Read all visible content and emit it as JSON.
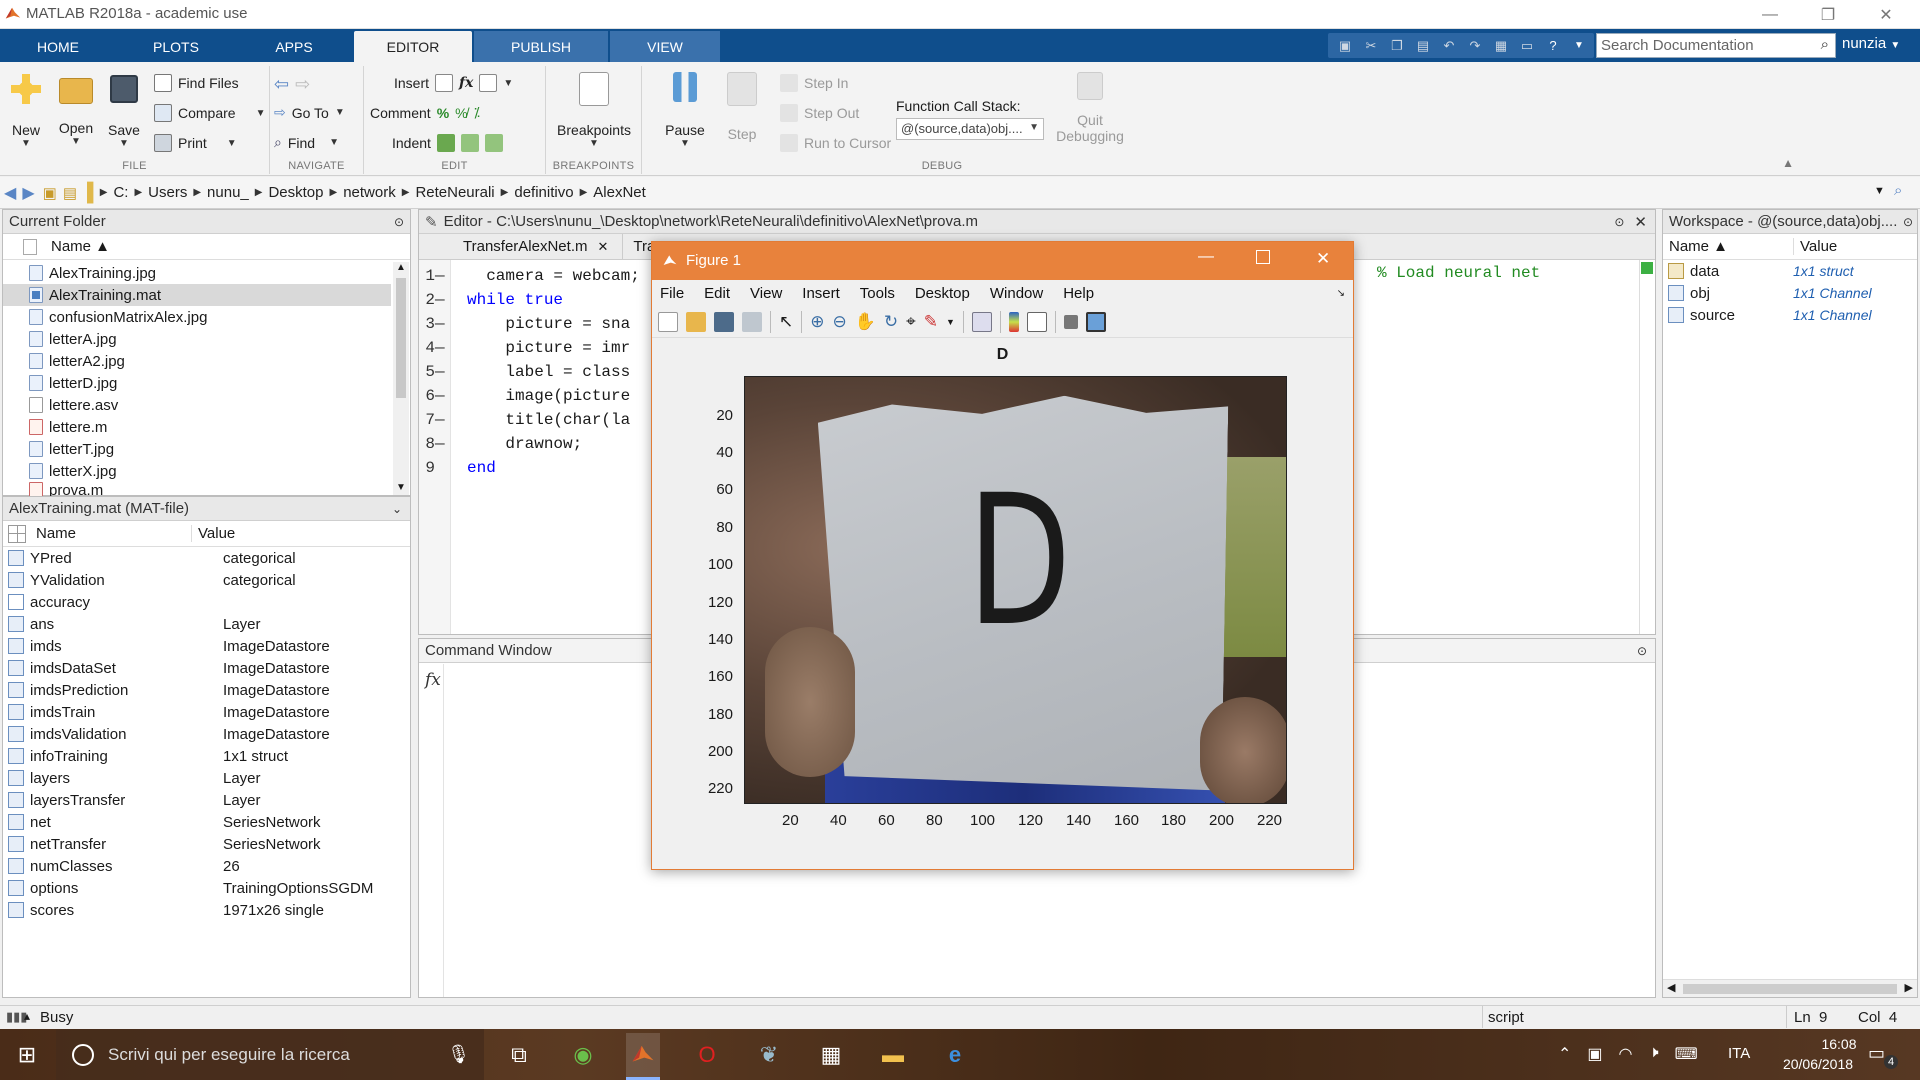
{
  "window": {
    "title": "MATLAB R2018a - academic use",
    "min": "—",
    "max": "❐",
    "close": "✕"
  },
  "tabs": [
    {
      "label": "HOME"
    },
    {
      "label": "PLOTS"
    },
    {
      "label": "APPS"
    },
    {
      "label": "EDITOR"
    },
    {
      "label": "PUBLISH"
    },
    {
      "label": "VIEW"
    }
  ],
  "search": {
    "placeholder": "Search Documentation"
  },
  "user": "nunzia",
  "ribbon": {
    "file": {
      "new": "New",
      "open": "Open",
      "save": "Save",
      "find_files": "Find Files",
      "compare": "Compare",
      "print": "Print",
      "label": "FILE"
    },
    "navigate": {
      "go_to": "Go To",
      "find": "Find",
      "label": "NAVIGATE"
    },
    "edit": {
      "insert": "Insert",
      "comment": "Comment",
      "indent": "Indent",
      "label": "EDIT"
    },
    "breakpoints": {
      "button": "Breakpoints",
      "label": "BREAKPOINTS"
    },
    "debug": {
      "pause": "Pause",
      "step": "Step",
      "step_in": "Step In",
      "step_out": "Step Out",
      "run_to_cursor": "Run to Cursor",
      "call_stack_label": "Function Call Stack:",
      "call_stack_value": "@(source,data)obj....",
      "quit": "Quit",
      "quit2": "Debugging",
      "label": "DEBUG"
    }
  },
  "address": [
    "C:",
    "Users",
    "nunu_",
    "Desktop",
    "network",
    "ReteNeurali",
    "definitivo",
    "AlexNet"
  ],
  "current_folder": {
    "title": "Current Folder",
    "col_name": "Name ▲",
    "files": [
      {
        "name": "AlexTraining.jpg",
        "type": "img"
      },
      {
        "name": "AlexTraining.mat",
        "type": "mat"
      },
      {
        "name": "confusionMatrixAlex.jpg",
        "type": "img"
      },
      {
        "name": "letterA.jpg",
        "type": "img"
      },
      {
        "name": "letterA2.jpg",
        "type": "img"
      },
      {
        "name": "letterD.jpg",
        "type": "img"
      },
      {
        "name": "lettere.asv",
        "type": "doc"
      },
      {
        "name": "lettere.m",
        "type": "m"
      },
      {
        "name": "letterT.jpg",
        "type": "img"
      },
      {
        "name": "letterX.jpg",
        "type": "img"
      },
      {
        "name": "prova.m",
        "type": "m"
      }
    ]
  },
  "details": {
    "title": "AlexTraining.mat  (MAT-file)",
    "col_name": "Name",
    "col_value": "Value",
    "vars": [
      {
        "name": "YPred",
        "value": "categorical"
      },
      {
        "name": "YValidation",
        "value": "categorical"
      },
      {
        "name": "accuracy",
        "value": ""
      },
      {
        "name": "ans",
        "value": "Layer"
      },
      {
        "name": "imds",
        "value": "ImageDatastore"
      },
      {
        "name": "imdsDataSet",
        "value": "ImageDatastore"
      },
      {
        "name": "imdsPrediction",
        "value": "ImageDatastore"
      },
      {
        "name": "imdsTrain",
        "value": "ImageDatastore"
      },
      {
        "name": "imdsValidation",
        "value": "ImageDatastore"
      },
      {
        "name": "infoTraining",
        "value": "1x1 struct"
      },
      {
        "name": "layers",
        "value": "Layer"
      },
      {
        "name": "layersTransfer",
        "value": "Layer"
      },
      {
        "name": "net",
        "value": "SeriesNetwork"
      },
      {
        "name": "netTransfer",
        "value": "SeriesNetwork"
      },
      {
        "name": "numClasses",
        "value": "26"
      },
      {
        "name": "options",
        "value": "TrainingOptionsSGDM"
      },
      {
        "name": "scores",
        "value": "1971x26 single"
      }
    ]
  },
  "editor": {
    "title": "Editor - C:\\Users\\nunu_\\Desktop\\network\\ReteNeurali\\definitivo\\AlexNet\\prova.m",
    "tabs": [
      "TransferAlexNet.m",
      "Tran"
    ],
    "lines": [
      {
        "n": "1",
        "dash": "—",
        "code": "  camera = webcam;"
      },
      {
        "n": "2",
        "dash": "—",
        "code": "while true"
      },
      {
        "n": "3",
        "dash": "—",
        "code": "    picture = sna"
      },
      {
        "n": "4",
        "dash": "—",
        "code": "    picture = imr"
      },
      {
        "n": "5",
        "dash": "—",
        "code": "    label = class"
      },
      {
        "n": "6",
        "dash": "—",
        "code": "    image(picture"
      },
      {
        "n": "7",
        "dash": "—",
        "code": "    title(char(la"
      },
      {
        "n": "8",
        "dash": "—",
        "code": "    drawnow;"
      },
      {
        "n": "9",
        "dash": "",
        "code": "end"
      }
    ],
    "comment": "% Load neural net"
  },
  "command_window": {
    "title": "Command Window",
    "prompt": "fx"
  },
  "workspace": {
    "title": "Workspace - @(source,data)obj....",
    "col_name": "Name ▲",
    "col_value": "Value",
    "vars": [
      {
        "name": "data",
        "value": "1x1 struct"
      },
      {
        "name": "obj",
        "value": "1x1 Channel"
      },
      {
        "name": "source",
        "value": "1x1 Channel"
      }
    ]
  },
  "figure": {
    "title": "Figure 1",
    "menu": [
      "File",
      "Edit",
      "View",
      "Insert",
      "Tools",
      "Desktop",
      "Window",
      "Help"
    ],
    "plot_title": "D",
    "yticks": [
      "20",
      "40",
      "60",
      "80",
      "100",
      "120",
      "140",
      "160",
      "180",
      "200",
      "220"
    ],
    "xticks": [
      "20",
      "40",
      "60",
      "80",
      "100",
      "120",
      "140",
      "160",
      "180",
      "200",
      "220"
    ],
    "letter": "D"
  },
  "status": {
    "busy": "Busy",
    "mode": "script",
    "ln": "Ln  9",
    "col": "Col  4"
  },
  "taskbar": {
    "search": "Scrivi qui per eseguire la ricerca",
    "lang": "ITA",
    "time": "16:08",
    "date": "20/06/2018",
    "notif": "4"
  },
  "colors": {
    "ribbon_tab_blue": "#0f4e8c",
    "figure_title": "#e8823c"
  }
}
